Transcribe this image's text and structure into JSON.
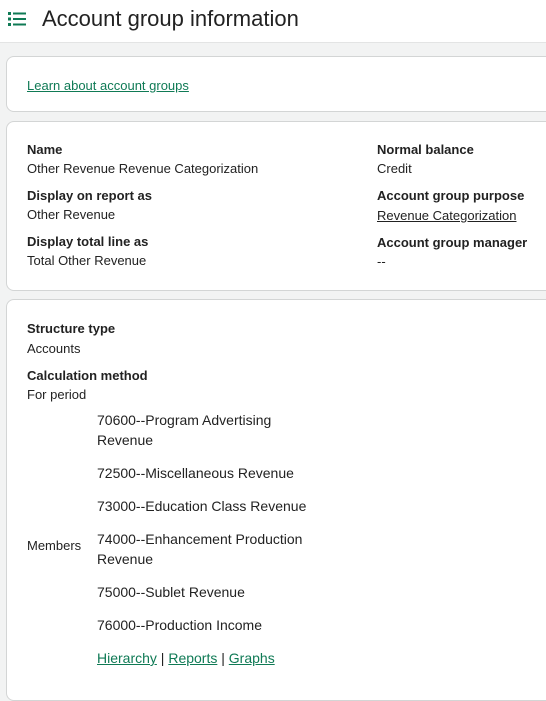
{
  "header": {
    "title": "Account group information",
    "menu_icon": "list-icon",
    "accent_color": "#0f7a55"
  },
  "learn": {
    "link_label": "Learn about account groups"
  },
  "details": {
    "name_label": "Name",
    "name_value": "Other Revenue Revenue Categorization",
    "display_on_report_label": "Display on report as",
    "display_on_report_value": "Other Revenue",
    "display_total_label": "Display total line as",
    "display_total_value": "Total Other Revenue",
    "normal_balance_label": "Normal balance",
    "normal_balance_value": "Credit",
    "purpose_label": "Account group purpose",
    "purpose_value": "Revenue Categorization",
    "manager_label": "Account group manager",
    "manager_value": "--"
  },
  "structure": {
    "structure_type_label": "Structure type",
    "structure_type_value": "Accounts",
    "calc_method_label": "Calculation method",
    "calc_method_value": "For period",
    "members_label": "Members",
    "members": [
      "70600--Program Advertising Revenue",
      "72500--Miscellaneous Revenue",
      "73000--Education Class Revenue",
      "74000--Enhancement Production Revenue",
      "75000--Sublet Revenue",
      "76000--Production Income"
    ],
    "links": {
      "hierarchy": "Hierarchy",
      "reports": "Reports",
      "graphs": "Graphs",
      "separator": "|"
    }
  }
}
